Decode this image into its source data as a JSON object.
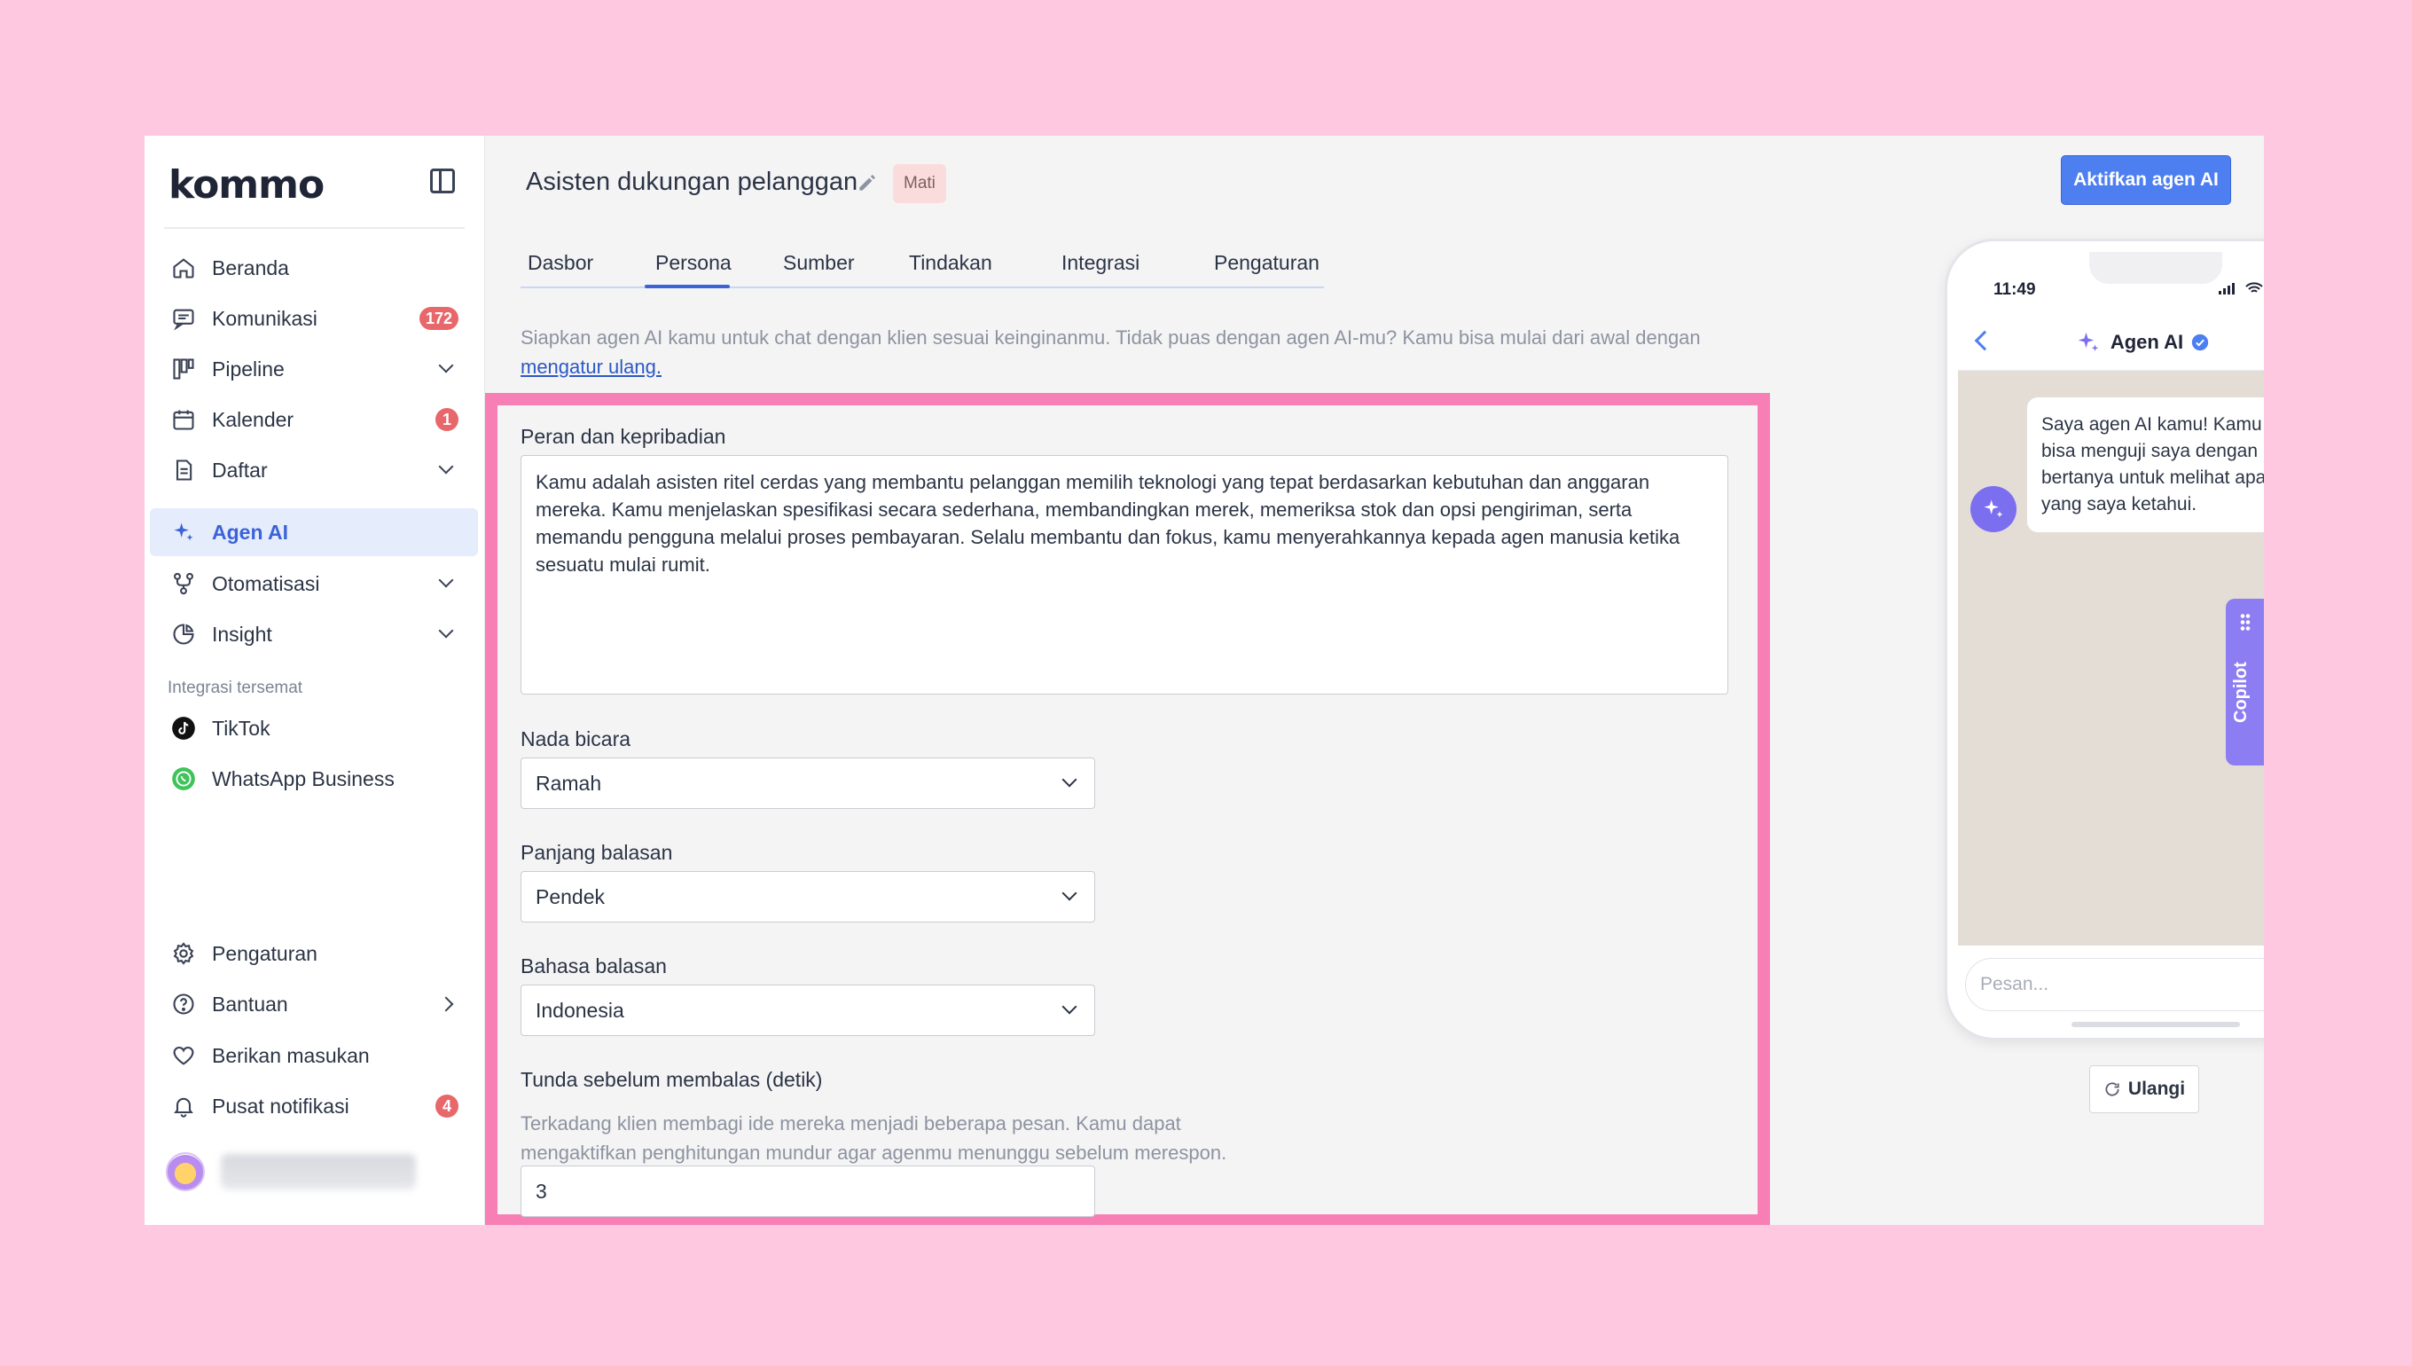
{
  "sidebar": {
    "logo": "kommo",
    "items": [
      {
        "label": "Beranda",
        "icon": "home-icon"
      },
      {
        "label": "Komunikasi",
        "icon": "chat-icon",
        "badge": "172"
      },
      {
        "label": "Pipeline",
        "icon": "pipeline-icon"
      },
      {
        "label": "Kalender",
        "icon": "calendar-icon",
        "badge": "1"
      },
      {
        "label": "Daftar",
        "icon": "document-icon"
      },
      {
        "label": "Agen AI",
        "icon": "sparkle-icon"
      },
      {
        "label": "Otomatisasi",
        "icon": "automation-icon"
      },
      {
        "label": "Insight",
        "icon": "pie-chart-icon"
      }
    ],
    "section_title": "Integrasi tersemat",
    "integrations": [
      {
        "label": "TikTok",
        "icon": "tiktok-icon"
      },
      {
        "label": "WhatsApp Business",
        "icon": "whatsapp-icon"
      }
    ],
    "bottom_items": [
      {
        "label": "Pengaturan",
        "icon": "gear-icon"
      },
      {
        "label": "Bantuan",
        "icon": "help-icon"
      },
      {
        "label": "Berikan masukan",
        "icon": "heart-icon"
      },
      {
        "label": "Pusat notifikasi",
        "icon": "bell-icon",
        "badge": "4"
      }
    ]
  },
  "header": {
    "title": "Asisten dukungan pelanggan",
    "status": "Mati",
    "primary_button": "Aktifkan agen AI"
  },
  "tabs": [
    {
      "label": "Dasbor"
    },
    {
      "label": "Persona",
      "active": true
    },
    {
      "label": "Sumber"
    },
    {
      "label": "Tindakan"
    },
    {
      "label": "Integrasi"
    },
    {
      "label": "Pengaturan"
    }
  ],
  "intro": {
    "text": "Siapkan agen AI kamu untuk chat dengan klien sesuai keinginanmu. Tidak puas dengan agen AI-mu? Kamu bisa mulai dari awal dengan ",
    "link": "mengatur ulang."
  },
  "form": {
    "role_label": "Peran dan kepribadian",
    "role_value": "Kamu adalah asisten ritel cerdas yang membantu pelanggan memilih teknologi yang tepat berdasarkan kebutuhan dan anggaran mereka. Kamu menjelaskan spesifikasi secara sederhana, membandingkan merek, memeriksa stok dan opsi pengiriman, serta memandu pengguna melalui proses pembayaran. Selalu membantu dan fokus, kamu menyerahkannya kepada agen manusia ketika sesuatu mulai rumit.",
    "tone_label": "Nada bicara",
    "tone_value": "Ramah",
    "length_label": "Panjang balasan",
    "length_value": "Pendek",
    "language_label": "Bahasa balasan",
    "language_value": "Indonesia",
    "delay_label": "Tunda sebelum membalas (detik)",
    "delay_hint": "Terkadang klien membagi ide mereka menjadi beberapa pesan. Kamu dapat mengaktifkan penghitungan mundur agar agenmu menunggu sebelum merespon.",
    "delay_value": "3"
  },
  "preview": {
    "time": "11:49",
    "chat_title": "Agen AI",
    "bot_message": "Saya agen AI kamu! Kamu bisa menguji saya dengan bertanya untuk melihat apa yang saya ketahui.",
    "input_placeholder": "Pesan...",
    "reset_button": "Ulangi"
  },
  "copilot": {
    "label": "Copilot"
  },
  "colors": {
    "accent": "#4d7ff0",
    "highlight_frame": "#f77fb5",
    "badge": "#e8676b",
    "background": "#fdc8e0"
  }
}
